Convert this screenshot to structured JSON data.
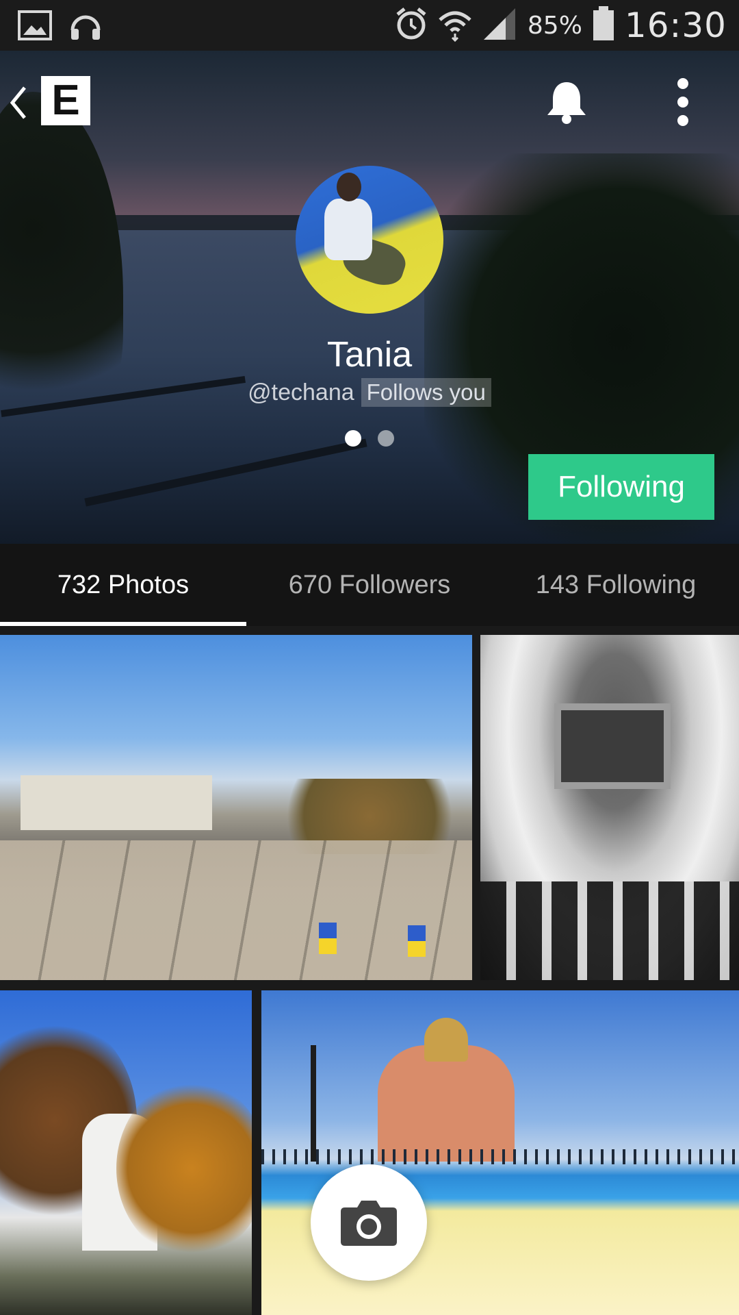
{
  "status_bar": {
    "left_icons": [
      "image-icon",
      "headphones-icon"
    ],
    "right_icons": [
      "alarm-icon",
      "wifi-icon",
      "signal-icon",
      "battery-icon"
    ],
    "battery": "85%",
    "time": "16:30"
  },
  "header": {
    "back_icon": "chevron-left-icon",
    "logo_letter": "E",
    "notification_icon": "bell-icon",
    "menu_icon": "more-vertical-icon",
    "profile": {
      "name": "Tania",
      "handle": "@techana",
      "follows_you": "Follows you"
    },
    "pager": {
      "count": 2,
      "active": 0
    },
    "follow_button": "Following"
  },
  "tabs": [
    {
      "label": "732 Photos",
      "active": true
    },
    {
      "label": "670 Followers",
      "active": false
    },
    {
      "label": "143 Following",
      "active": false
    }
  ],
  "fab_icon": "camera-icon",
  "colors": {
    "accent": "#2ec98a",
    "status_bar": "#1b1b1b",
    "tab_bar": "#141414"
  }
}
